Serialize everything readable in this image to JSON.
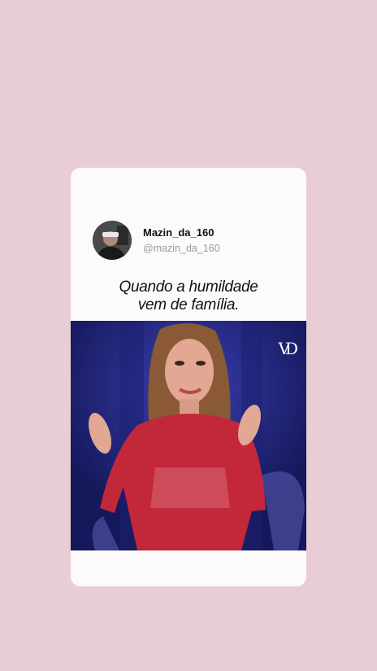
{
  "post": {
    "display_name": "Mazin_da_160",
    "handle": "@mazin_da_160",
    "caption_line1": "Quando a humildade",
    "caption_line2": "vem de família.",
    "video_watermark": "VD"
  },
  "colors": {
    "page_background": "#e8cdd5",
    "card_background": "#fdfafb",
    "video_background": "#23288a"
  },
  "icons": {
    "avatar": "profile-photo",
    "watermark": "vd-logo"
  }
}
